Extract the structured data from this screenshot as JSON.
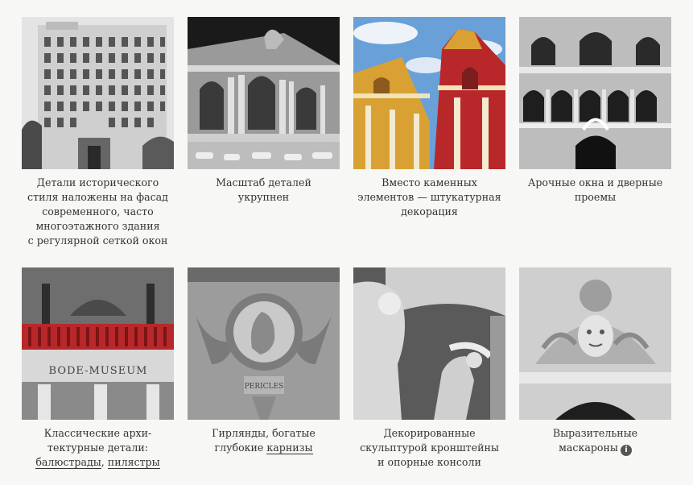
{
  "cards": [
    {
      "lines": [
        "Детали исторического",
        "стиля наложены на фасад",
        "современного, часто",
        "многоэтажного здания",
        "с регулярной сеткой окон"
      ],
      "image": "building-facade-photo"
    },
    {
      "lines": [
        "Масштаб деталей",
        "укрупнен"
      ],
      "image": "grand-central-photo"
    },
    {
      "lines": [
        "Вместо каменных",
        "элементов — штукатурная",
        "декорация"
      ],
      "image": "church-towers-photo"
    },
    {
      "lines": [
        "Арочные окна и дверные",
        "проемы"
      ],
      "image": "arched-windows-photo"
    },
    {
      "lines": [
        "Классические архи-",
        "тектурные детали:"
      ],
      "links": [
        "балюстрады",
        "пилястры"
      ],
      "sep": ", ",
      "image": "bode-museum-photo"
    },
    {
      "lines": [
        "Гирлянды, богатые"
      ],
      "prefix": "глубокие ",
      "link": "карнизы",
      "image": "garland-medallion-photo"
    },
    {
      "lines": [
        "Декорированные",
        "скульптурой кронштейны",
        "и опорные консоли"
      ],
      "image": "atlas-sculpture-photo"
    },
    {
      "lines": [
        "Выразительные"
      ],
      "last": "маскароны",
      "info_icon": "info-icon",
      "info_glyph": "i",
      "image": "mascaron-photo"
    }
  ],
  "bode_text": "BODE-MUSEUM",
  "plaque_text": "PERICLES",
  "colors": {
    "background": "#f7f7f5",
    "text": "#333333",
    "balustrade_red": "#b8282a",
    "church_orange": "#d9a033",
    "sky": "#6aa0d8"
  }
}
